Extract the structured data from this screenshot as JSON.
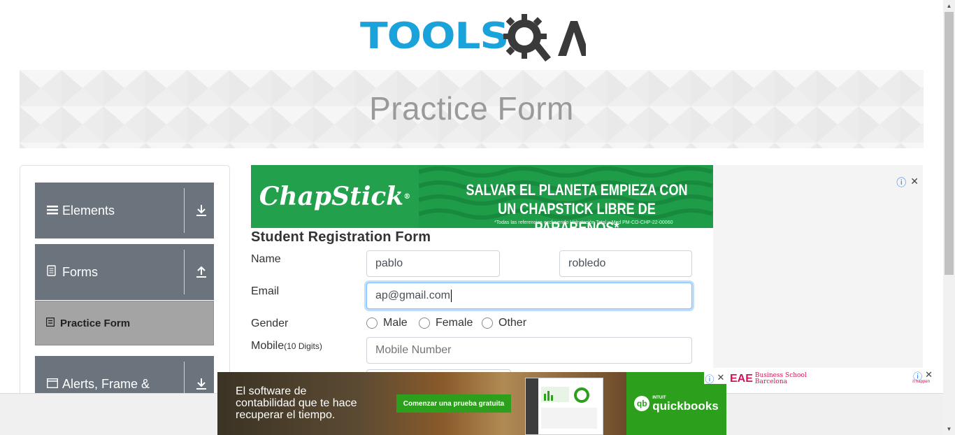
{
  "brand": {
    "logo_text": "TOOLS",
    "logo_suffix": "A"
  },
  "page": {
    "title": "Practice Form"
  },
  "sidebar": {
    "groups": [
      {
        "label": "Elements"
      },
      {
        "label": "Forms"
      },
      {
        "label": "Alerts, Frame &"
      }
    ],
    "active_item": "Practice Form"
  },
  "ads": {
    "top": {
      "brand": "ChapStick",
      "headline": "SALVAR EL PLANETA EMPIEZA CON UN CHAPSTICK LIBRE DE PARABENOS*",
      "fine_print": "*Todas las referencias excluyendo Hidratación Total y Med  PM-CO-CHP-22-00060"
    },
    "bottom": {
      "copy_line1": "El software de",
      "copy_line2": "contabilidad que te hace",
      "copy_line3": "recuperar el tiempo.",
      "cta": "Comenzar una prueba gratuita",
      "brand_small": "INTUIT",
      "brand": "quickbooks"
    },
    "small": {
      "brand": "EAE",
      "subtitle_line1": "Business School",
      "subtitle_line2": "Barcelona",
      "tag": "it happen"
    }
  },
  "form": {
    "title": "Student Registration Form",
    "name_label": "Name",
    "first_name": "pablo",
    "last_name": "robledo",
    "email_label": "Email",
    "email_value": "ap@gmail.com",
    "gender_label": "Gender",
    "gender_options": [
      "Male",
      "Female",
      "Other"
    ],
    "mobile_label": "Mobile",
    "mobile_hint": "(10 Digits)",
    "mobile_placeholder": "Mobile Number"
  }
}
